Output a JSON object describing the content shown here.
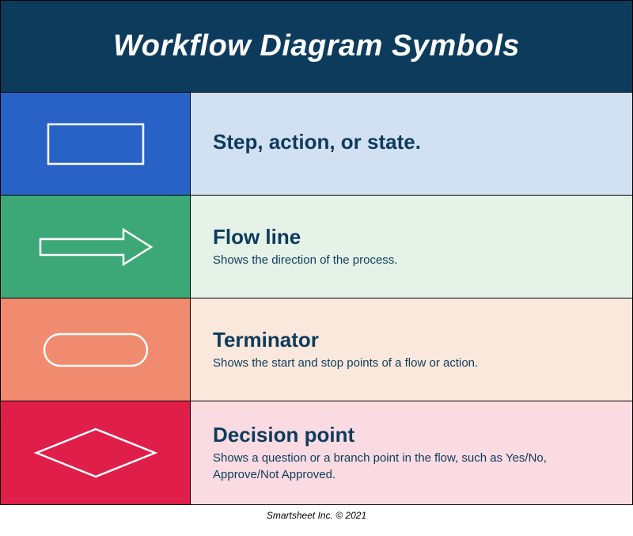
{
  "header": {
    "title": "Workflow Diagram Symbols"
  },
  "rows": [
    {
      "title": "Step, action, or state.",
      "subtitle": ""
    },
    {
      "title": "Flow line",
      "subtitle": "Shows the direction of the process."
    },
    {
      "title": "Terminator",
      "subtitle": "Shows the start and stop points of a flow or action."
    },
    {
      "title": "Decision point",
      "subtitle": "Shows a question or a branch point in the flow, such as Yes/No, Approve/Not Approved."
    }
  ],
  "footer": "Smartsheet Inc. © 2021"
}
